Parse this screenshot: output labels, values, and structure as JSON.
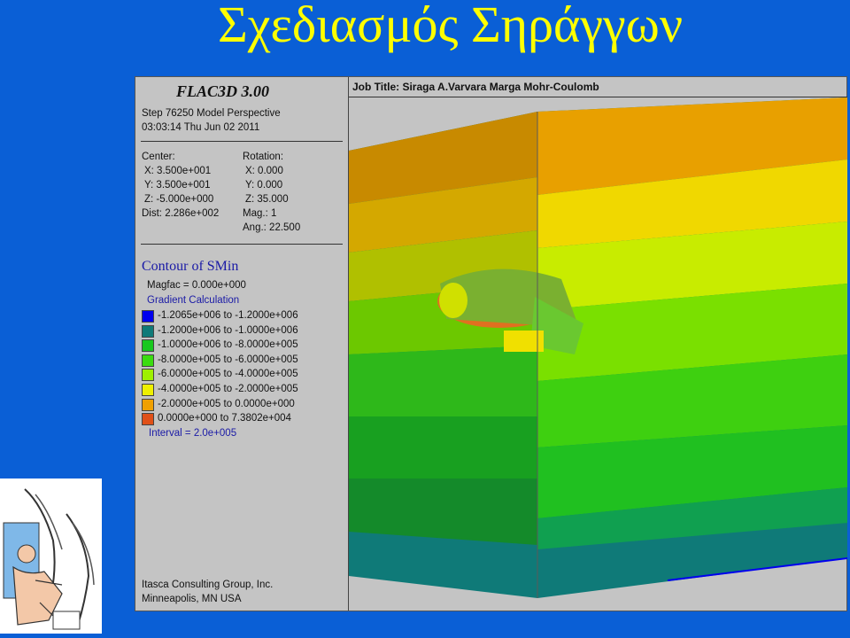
{
  "slide": {
    "title": "Σχεδιασμός Σηράγγων"
  },
  "app": {
    "title": "FLAC3D 3.00",
    "step": "Step 76250  Model Perspective",
    "datetime": "03:03:14 Thu Jun 02 2011"
  },
  "view": {
    "center_label": "Center:",
    "center_x": "X: 3.500e+001",
    "center_y": "Y: 3.500e+001",
    "center_z": "Z: -5.000e+000",
    "dist": "Dist: 2.286e+002",
    "rotation_label": "Rotation:",
    "rot_x": "X:   0.000",
    "rot_y": "Y:   0.000",
    "rot_z": "Z:  35.000",
    "mag": "Mag.:      1",
    "ang": "Ang.:  22.500"
  },
  "contour": {
    "title": "Contour of SMin",
    "magfac": "Magfac =  0.000e+000",
    "gradient": "Gradient Calculation",
    "legend": [
      {
        "label": "-1.2065e+006 to -1.2000e+006",
        "color": "#0000ee"
      },
      {
        "label": "-1.2000e+006 to -1.0000e+006",
        "color": "#0f7a78"
      },
      {
        "label": "-1.0000e+006 to -8.0000e+005",
        "color": "#18c81e"
      },
      {
        "label": "-8.0000e+005 to -6.0000e+005",
        "color": "#3bdc10"
      },
      {
        "label": "-6.0000e+005 to -4.0000e+005",
        "color": "#9ef000"
      },
      {
        "label": "-4.0000e+005 to -2.0000e+005",
        "color": "#eef000"
      },
      {
        "label": "-2.0000e+005 to  0.0000e+000",
        "color": "#f0a000"
      },
      {
        "label": " 0.0000e+000 to  7.3802e+004",
        "color": "#e05018"
      }
    ],
    "interval": "Interval =  2.0e+005"
  },
  "credits": {
    "line1": "Itasca Consulting Group, Inc.",
    "line2": "Minneapolis, MN  USA"
  },
  "job": {
    "title": "Job Title: Siraga A.Varvara Marga Mohr-Coulomb"
  },
  "colors": {
    "background": "#0a5fd6",
    "title": "#ffff00",
    "panel": "#c4c4c4"
  }
}
